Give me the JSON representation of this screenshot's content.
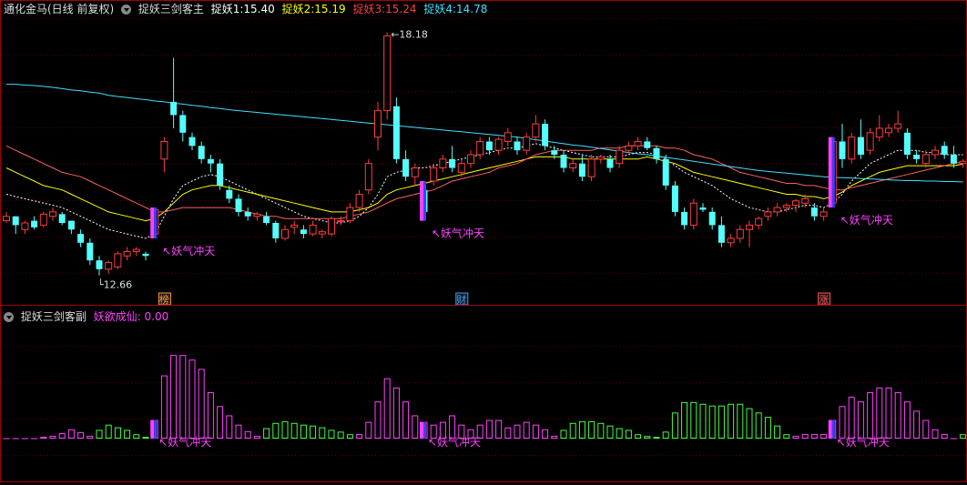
{
  "main_panel": {
    "stock_label": "通化金马(日线 前复权)",
    "indicator_name": "捉妖三剑客主",
    "legend": [
      {
        "label": "捉妖1",
        "value": "15.40",
        "color": "#ffffff"
      },
      {
        "label": "捉妖2",
        "value": "15.19",
        "color": "#ffff00"
      },
      {
        "label": "捉妖3",
        "value": "15.24",
        "color": "#ff4040"
      },
      {
        "label": "捉妖4",
        "value": "14.78",
        "color": "#40e0ff"
      }
    ],
    "high_label": "18.18",
    "low_label": "12.66",
    "signal_text": "妖气冲天",
    "event_badges": [
      {
        "text": "榜",
        "color": "#ff9a3c"
      },
      {
        "text": "财",
        "color": "#3c9cff"
      },
      {
        "text": "涨",
        "color": "#ff4b4b"
      }
    ]
  },
  "sub_panel": {
    "indicator_name": "捉妖三剑客副",
    "legend_label": "妖欲成仙",
    "legend_value": "0.00",
    "signal_text": "妖气冲天"
  },
  "colors": {
    "up": "#ff3c3c",
    "down": "#54ffff",
    "ma_white": "#ffffff",
    "ma_yellow": "#ffff00",
    "ma_red": "#ff6060",
    "ma_cyan": "#40e0ff",
    "signal": "#ff40ff",
    "hist_pos": "#ff40ff",
    "hist_neg": "#40ff40"
  },
  "chart_data": [
    {
      "type": "candlestick",
      "title": "捉妖三剑客主",
      "ylim": [
        12.3,
        18.5
      ],
      "candles": [
        [
          13.9,
          14.1,
          13.85,
          14.0
        ],
        [
          14.0,
          14.0,
          13.6,
          13.8
        ],
        [
          13.7,
          13.9,
          13.6,
          13.85
        ],
        [
          13.9,
          14.0,
          13.7,
          13.75
        ],
        [
          13.8,
          14.1,
          13.75,
          14.05
        ],
        [
          14.0,
          14.2,
          13.9,
          14.1
        ],
        [
          14.05,
          14.1,
          13.8,
          13.85
        ],
        [
          13.9,
          13.9,
          13.6,
          13.7
        ],
        [
          13.6,
          13.7,
          13.3,
          13.4
        ],
        [
          13.4,
          13.5,
          12.9,
          13.0
        ],
        [
          13.0,
          13.1,
          12.66,
          12.8
        ],
        [
          12.8,
          13.0,
          12.7,
          12.95
        ],
        [
          12.85,
          13.2,
          12.8,
          13.15
        ],
        [
          13.1,
          13.3,
          13.0,
          13.2
        ],
        [
          13.2,
          13.3,
          13.1,
          13.25
        ],
        [
          13.15,
          13.2,
          13.0,
          13.1
        ],
        [
          13.6,
          14.2,
          13.5,
          14.15
        ],
        [
          15.3,
          15.8,
          15.0,
          15.7
        ],
        [
          16.6,
          17.6,
          16.0,
          16.3
        ],
        [
          16.3,
          16.4,
          15.7,
          15.9
        ],
        [
          15.8,
          15.9,
          15.5,
          15.6
        ],
        [
          15.6,
          15.7,
          15.2,
          15.3
        ],
        [
          15.3,
          15.4,
          15.0,
          15.2
        ],
        [
          15.2,
          15.3,
          14.6,
          14.7
        ],
        [
          14.6,
          14.7,
          14.3,
          14.4
        ],
        [
          14.4,
          14.5,
          14.0,
          14.1
        ],
        [
          14.1,
          14.2,
          13.9,
          14.0
        ],
        [
          14.0,
          14.1,
          13.9,
          14.05
        ],
        [
          14.0,
          14.1,
          13.8,
          13.85
        ],
        [
          13.85,
          13.9,
          13.4,
          13.5
        ],
        [
          13.5,
          13.8,
          13.45,
          13.7
        ],
        [
          13.75,
          13.9,
          13.6,
          13.8
        ],
        [
          13.7,
          13.8,
          13.5,
          13.6
        ],
        [
          13.6,
          13.9,
          13.55,
          13.8
        ],
        [
          13.6,
          13.7,
          13.5,
          13.65
        ],
        [
          13.6,
          14.0,
          13.55,
          13.95
        ],
        [
          13.9,
          14.0,
          13.8,
          13.9
        ],
        [
          13.9,
          14.3,
          13.85,
          14.2
        ],
        [
          14.2,
          14.6,
          14.1,
          14.5
        ],
        [
          14.6,
          15.3,
          14.5,
          15.2
        ],
        [
          15.8,
          16.6,
          15.5,
          16.4
        ],
        [
          16.4,
          18.18,
          16.2,
          18.1
        ],
        [
          16.5,
          16.7,
          15.2,
          15.3
        ],
        [
          15.3,
          15.5,
          14.8,
          14.9
        ],
        [
          14.9,
          15.2,
          14.7,
          15.1
        ],
        [
          14.6,
          14.8,
          13.9,
          14.1
        ],
        [
          14.8,
          15.2,
          14.7,
          15.1
        ],
        [
          15.1,
          15.4,
          15.0,
          15.3
        ],
        [
          15.3,
          15.6,
          15.0,
          15.1
        ],
        [
          15.0,
          15.3,
          14.9,
          15.2
        ],
        [
          15.2,
          15.5,
          15.1,
          15.4
        ],
        [
          15.4,
          15.8,
          15.3,
          15.7
        ],
        [
          15.7,
          15.8,
          15.4,
          15.5
        ],
        [
          15.5,
          15.8,
          15.4,
          15.75
        ],
        [
          15.7,
          16.0,
          15.6,
          15.9
        ],
        [
          15.7,
          15.8,
          15.4,
          15.5
        ],
        [
          15.5,
          15.9,
          15.4,
          15.8
        ],
        [
          15.8,
          16.3,
          15.7,
          16.1
        ],
        [
          16.1,
          16.2,
          15.5,
          15.6
        ],
        [
          15.5,
          15.6,
          15.3,
          15.4
        ],
        [
          15.4,
          15.5,
          15.0,
          15.1
        ],
        [
          15.1,
          15.3,
          15.0,
          15.2
        ],
        [
          15.2,
          15.4,
          14.8,
          14.9
        ],
        [
          14.9,
          15.4,
          14.8,
          15.3
        ],
        [
          15.3,
          15.4,
          15.2,
          15.35
        ],
        [
          15.3,
          15.4,
          15.0,
          15.1
        ],
        [
          15.2,
          15.6,
          15.1,
          15.5
        ],
        [
          15.5,
          15.7,
          15.4,
          15.6
        ],
        [
          15.6,
          15.8,
          15.5,
          15.7
        ],
        [
          15.7,
          15.8,
          15.5,
          15.55
        ],
        [
          15.55,
          15.6,
          15.2,
          15.3
        ],
        [
          15.3,
          15.4,
          14.6,
          14.7
        ],
        [
          14.7,
          14.8,
          14.0,
          14.1
        ],
        [
          14.1,
          14.2,
          13.7,
          13.8
        ],
        [
          13.8,
          14.4,
          13.7,
          14.3
        ],
        [
          14.2,
          14.3,
          14.1,
          14.15
        ],
        [
          14.1,
          14.2,
          13.7,
          13.8
        ],
        [
          13.8,
          14.0,
          13.3,
          13.4
        ],
        [
          13.4,
          13.6,
          13.3,
          13.5
        ],
        [
          13.5,
          13.8,
          13.4,
          13.7
        ],
        [
          13.7,
          13.9,
          13.3,
          13.8
        ],
        [
          13.8,
          14.0,
          13.7,
          13.95
        ],
        [
          14.0,
          14.2,
          13.9,
          14.1
        ],
        [
          14.1,
          14.3,
          14.0,
          14.2
        ],
        [
          14.2,
          14.3,
          14.1,
          14.25
        ],
        [
          14.25,
          14.4,
          14.1,
          14.35
        ],
        [
          14.3,
          14.5,
          14.2,
          14.4
        ],
        [
          14.2,
          14.3,
          13.9,
          14.0
        ],
        [
          14.0,
          14.2,
          13.9,
          14.1
        ],
        [
          14.3,
          15.8,
          14.2,
          15.7
        ],
        [
          15.7,
          16.1,
          15.1,
          15.3
        ],
        [
          15.3,
          15.9,
          15.2,
          15.8
        ],
        [
          15.8,
          16.2,
          15.3,
          15.4
        ],
        [
          15.5,
          16.0,
          15.4,
          15.9
        ],
        [
          15.8,
          16.3,
          15.7,
          16.0
        ],
        [
          15.9,
          16.1,
          15.8,
          16.0
        ],
        [
          16.0,
          16.4,
          15.9,
          16.1
        ],
        [
          15.9,
          16.0,
          15.3,
          15.4
        ],
        [
          15.4,
          15.5,
          15.2,
          15.3
        ],
        [
          15.2,
          15.5,
          15.1,
          15.4
        ],
        [
          15.4,
          15.6,
          15.3,
          15.5
        ],
        [
          15.6,
          15.7,
          15.3,
          15.4
        ],
        [
          15.4,
          15.6,
          15.1,
          15.2
        ],
        [
          15.2,
          15.3,
          15.1,
          15.25
        ]
      ],
      "series": [
        {
          "name": "捉妖1",
          "color": "#ffffff",
          "style": "dashed",
          "values": [
            14.5,
            14.45,
            14.4,
            14.35,
            14.3,
            14.25,
            14.2,
            14.1,
            14.0,
            13.9,
            13.8,
            13.7,
            13.65,
            13.6,
            13.55,
            13.5,
            13.6,
            14.0,
            14.4,
            14.7,
            14.8,
            14.9,
            14.95,
            14.9,
            14.8,
            14.7,
            14.6,
            14.5,
            14.4,
            14.3,
            14.2,
            14.1,
            14.0,
            13.95,
            13.9,
            13.85,
            13.85,
            13.9,
            14.0,
            14.2,
            14.5,
            14.9,
            15.0,
            15.05,
            15.1,
            15.1,
            15.15,
            15.2,
            15.25,
            15.3,
            15.35,
            15.4,
            15.45,
            15.5,
            15.55,
            15.55,
            15.6,
            15.65,
            15.6,
            15.55,
            15.5,
            15.45,
            15.4,
            15.35,
            15.35,
            15.35,
            15.35,
            15.4,
            15.45,
            15.45,
            15.4,
            15.3,
            15.15,
            15.0,
            14.9,
            14.8,
            14.7,
            14.55,
            14.4,
            14.3,
            14.2,
            14.15,
            14.1,
            14.1,
            14.15,
            14.2,
            14.25,
            14.25,
            14.2,
            14.3,
            14.5,
            14.8,
            15.0,
            15.2,
            15.3,
            15.4,
            15.5,
            15.5,
            15.5,
            15.45,
            15.45,
            15.4,
            15.4,
            15.4
          ]
        },
        {
          "name": "捉妖2",
          "color": "#ffff00",
          "style": "solid",
          "values": [
            15.1,
            15.0,
            14.9,
            14.8,
            14.7,
            14.65,
            14.6,
            14.5,
            14.4,
            14.3,
            14.2,
            14.1,
            14.05,
            14.0,
            13.95,
            13.9,
            13.95,
            14.1,
            14.3,
            14.5,
            14.6,
            14.65,
            14.7,
            14.7,
            14.65,
            14.6,
            14.55,
            14.5,
            14.45,
            14.4,
            14.35,
            14.3,
            14.25,
            14.2,
            14.15,
            14.1,
            14.1,
            14.1,
            14.15,
            14.2,
            14.3,
            14.5,
            14.6,
            14.65,
            14.7,
            14.75,
            14.8,
            14.85,
            14.9,
            14.95,
            15.0,
            15.05,
            15.1,
            15.15,
            15.2,
            15.25,
            15.3,
            15.35,
            15.35,
            15.35,
            15.35,
            15.3,
            15.3,
            15.3,
            15.3,
            15.3,
            15.3,
            15.3,
            15.3,
            15.35,
            15.3,
            15.25,
            15.2,
            15.1,
            15.0,
            14.95,
            14.9,
            14.85,
            14.8,
            14.75,
            14.7,
            14.65,
            14.6,
            14.55,
            14.5,
            14.5,
            14.45,
            14.45,
            14.4,
            14.45,
            14.55,
            14.7,
            14.8,
            14.9,
            15.0,
            15.05,
            15.1,
            15.15,
            15.15,
            15.15,
            15.15,
            15.15,
            15.15,
            15.19
          ]
        },
        {
          "name": "捉妖3",
          "color": "#ff6060",
          "style": "solid",
          "values": [
            15.6,
            15.5,
            15.4,
            15.3,
            15.2,
            15.1,
            15.0,
            14.95,
            14.9,
            14.8,
            14.7,
            14.6,
            14.5,
            14.4,
            14.3,
            14.2,
            14.1,
            14.1,
            14.15,
            14.2,
            14.2,
            14.2,
            14.2,
            14.2,
            14.2,
            14.15,
            14.1,
            14.05,
            14.0,
            14.0,
            13.95,
            13.95,
            13.95,
            13.95,
            13.95,
            13.95,
            13.95,
            14.0,
            14.05,
            14.1,
            14.2,
            14.3,
            14.4,
            14.45,
            14.5,
            14.55,
            14.6,
            14.7,
            14.8,
            14.85,
            14.9,
            14.95,
            15.0,
            15.1,
            15.15,
            15.2,
            15.3,
            15.4,
            15.45,
            15.5,
            15.5,
            15.5,
            15.5,
            15.5,
            15.55,
            15.55,
            15.55,
            15.6,
            15.6,
            15.6,
            15.6,
            15.55,
            15.55,
            15.5,
            15.4,
            15.35,
            15.3,
            15.2,
            15.1,
            15.0,
            14.95,
            14.9,
            14.85,
            14.8,
            14.75,
            14.75,
            14.7,
            14.7,
            14.65,
            14.6,
            14.6,
            14.65,
            14.7,
            14.75,
            14.8,
            14.85,
            14.9,
            14.95,
            15.0,
            15.05,
            15.1,
            15.15,
            15.2,
            15.24
          ]
        },
        {
          "name": "捉妖4",
          "color": "#40e0ff",
          "style": "solid",
          "values": [
            17.0,
            17.0,
            16.98,
            16.97,
            16.95,
            16.93,
            16.9,
            16.87,
            16.85,
            16.82,
            16.8,
            16.75,
            16.72,
            16.7,
            16.67,
            16.65,
            16.62,
            16.6,
            16.57,
            16.55,
            16.52,
            16.5,
            16.47,
            16.45,
            16.42,
            16.4,
            16.38,
            16.36,
            16.34,
            16.32,
            16.3,
            16.28,
            16.26,
            16.24,
            16.22,
            16.2,
            16.18,
            16.16,
            16.14,
            16.12,
            16.1,
            16.08,
            16.06,
            16.04,
            16.02,
            16.0,
            15.98,
            15.96,
            15.94,
            15.92,
            15.9,
            15.88,
            15.86,
            15.84,
            15.82,
            15.8,
            15.77,
            15.74,
            15.71,
            15.68,
            15.65,
            15.62,
            15.6,
            15.57,
            15.54,
            15.51,
            15.48,
            15.45,
            15.42,
            15.4,
            15.37,
            15.34,
            15.31,
            15.28,
            15.25,
            15.22,
            15.19,
            15.16,
            15.13,
            15.1,
            15.07,
            15.04,
            15.02,
            15.0,
            14.98,
            14.96,
            14.94,
            14.92,
            14.9,
            14.89,
            14.88,
            14.87,
            14.86,
            14.85,
            14.84,
            14.83,
            14.82,
            14.81,
            14.81,
            14.8,
            14.8,
            14.79,
            14.79,
            14.78
          ]
        }
      ],
      "signals": [
        16,
        45,
        89
      ]
    },
    {
      "type": "bar",
      "title": "捉妖三剑客副",
      "ylim": [
        -4.5,
        9.5
      ],
      "values": [
        0,
        0,
        0,
        0,
        0.2,
        0.3,
        0.6,
        1.0,
        0.7,
        0.3,
        -1.0,
        -1.6,
        -1.3,
        -1.0,
        -0.5,
        -0.2,
        2.0,
        6.8,
        9.0,
        9.0,
        8.5,
        7.5,
        5.0,
        3.5,
        2.5,
        1.5,
        0.8,
        0.3,
        -1.2,
        -1.8,
        -2.0,
        -1.8,
        -1.6,
        -1.5,
        -1.3,
        -1.0,
        -0.8,
        -0.5,
        0.5,
        1.8,
        4.0,
        6.5,
        5.5,
        4.0,
        2.5,
        1.8,
        1.5,
        1.8,
        2.5,
        1.5,
        1.0,
        1.5,
        2.0,
        2.0,
        1.2,
        1.5,
        1.8,
        1.5,
        1.0,
        0.3,
        -1.0,
        -1.8,
        -2.0,
        -2.0,
        -1.8,
        -1.5,
        -1.2,
        -1.0,
        -0.5,
        -0.3,
        -0.2,
        -0.8,
        -3.0,
        -4.2,
        -4.2,
        -4.0,
        -3.8,
        -3.8,
        -4.0,
        -4.0,
        -3.5,
        -3.0,
        -2.5,
        -1.5,
        -0.5,
        0.3,
        0.5,
        0.5,
        0.5,
        2.0,
        3.5,
        4.5,
        4.0,
        5.0,
        5.5,
        5.5,
        5.0,
        4.0,
        3.0,
        2.0,
        1.0,
        0.5,
        0,
        -0.5
      ]
    }
  ]
}
